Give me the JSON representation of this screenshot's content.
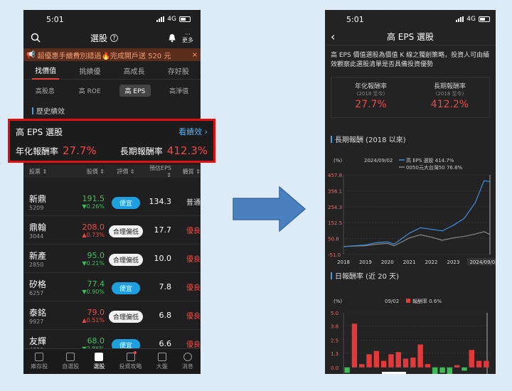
{
  "left_phone": {
    "status_time": "5:01",
    "network": "4G",
    "title": "選股",
    "more_label": "更多",
    "promo_text": "超優惠手續費別錯過🔥完成開戶送 520 元",
    "promo_close": "×",
    "tabs": [
      {
        "label": "找價值",
        "active": true
      },
      {
        "label": "挑績優",
        "active": false
      },
      {
        "label": "高成長",
        "active": false
      },
      {
        "label": "存好股",
        "active": false
      }
    ],
    "subtabs": [
      {
        "label": "高股息",
        "active": false
      },
      {
        "label": "高 ROE",
        "active": false
      },
      {
        "label": "高 EPS",
        "active": true
      },
      {
        "label": "高淨值",
        "active": false
      }
    ],
    "history_label": "歷史績效",
    "highlight": {
      "title": "高 EPS 選股",
      "link": "看績效 ›",
      "annual_label": "年化報酬率",
      "annual_value": "27.7%",
      "long_label": "長期報酬率",
      "long_value": "412.3%"
    },
    "table_headers": [
      "股票 ⇕",
      "股價 ⇕",
      "評價 ⇕",
      "預估EPS ⇕",
      "體質 ⇕"
    ],
    "rows": [
      {
        "name": "新鼎",
        "code": "5209",
        "price": "191.5",
        "change": "▼0.26%",
        "dir": "down",
        "rating": "便宜",
        "rating_type": "cheap",
        "eps": "134.3",
        "level": "普通",
        "level_type": "normal"
      },
      {
        "name": "鼎翰",
        "code": "3044",
        "price": "208.0",
        "change": "▲0.73%",
        "dir": "up",
        "rating": "合理偏低",
        "rating_type": "fair",
        "eps": "17.7",
        "level": "優良",
        "level_type": "good"
      },
      {
        "name": "新產",
        "code": "2850",
        "price": "95.0",
        "change": "▼0.21%",
        "dir": "down",
        "rating": "合理偏低",
        "rating_type": "fair",
        "eps": "10.0",
        "level": "優良",
        "level_type": "good"
      },
      {
        "name": "矽格",
        "code": "6257",
        "price": "77.4",
        "change": "▼0.90%",
        "dir": "down",
        "rating": "便宜",
        "rating_type": "cheap",
        "eps": "7.8",
        "level": "優良",
        "level_type": "good"
      },
      {
        "name": "泰銘",
        "code": "9927",
        "price": "79.0",
        "change": "▲0.51%",
        "dir": "up",
        "rating": "合理偏低",
        "rating_type": "fair",
        "eps": "6.8",
        "level": "優良",
        "level_type": "good"
      },
      {
        "name": "友輝",
        "code": "4933",
        "price": "68.0",
        "change": "▼2.86%",
        "dir": "down",
        "rating": "便宜",
        "rating_type": "cheap",
        "eps": "6.6",
        "level": "優良",
        "level_type": "good"
      }
    ],
    "nav": [
      {
        "label": "庫存股",
        "icon": "briefcase-icon",
        "active": false
      },
      {
        "label": "自選股",
        "icon": "plus-square-icon",
        "active": false
      },
      {
        "label": "選股",
        "icon": "database-icon",
        "active": true
      },
      {
        "label": "投資攻略",
        "icon": "book-icon",
        "active": false
      },
      {
        "label": "大盤",
        "icon": "compass-icon",
        "active": false
      },
      {
        "label": "消息",
        "icon": "chat-icon",
        "active": false
      }
    ]
  },
  "right_phone": {
    "status_time": "5:01",
    "network": "4G",
    "title": "高 EPS 選股",
    "description": "高 EPS 價值選股為價值 K 線之獨創策略，投資人可由績效觀察此選股清單是否具備投資優勢",
    "annual_label": "年化報酬率",
    "annual_sub": "(2018 至今)",
    "annual_value": "27.7%",
    "long_label": "長期報酬率",
    "long_sub": "(2018 至今)",
    "long_value": "412.2%",
    "long_section": "長期報酬 (2018 以來)",
    "daily_section": "日報酬率 (近 20 天)"
  },
  "chart_data": [
    {
      "type": "line",
      "title": "長期報酬 (2018 以來)",
      "ylabel": "(%)",
      "cursor_date": "2024/09/02",
      "x_ticks": [
        "2018",
        "2019",
        "2020",
        "2021",
        "2022",
        "2023",
        "2024/09/02"
      ],
      "y_ticks": [
        "457.8",
        "356.1",
        "254.3",
        "152.5",
        "50.8",
        "-51.0"
      ],
      "ylim": [
        -51.0,
        457.8
      ],
      "x": [
        2018.0,
        2018.5,
        2019.0,
        2019.5,
        2020.0,
        2020.3,
        2020.6,
        2021.0,
        2021.5,
        2022.0,
        2022.5,
        2023.0,
        2023.5,
        2024.0,
        2024.4,
        2024.67
      ],
      "series": [
        {
          "name": "高 EPS 選股 414.7%",
          "color": "#3a8fe0",
          "values": [
            0,
            5,
            10,
            25,
            30,
            15,
            45,
            85,
            120,
            110,
            100,
            135,
            180,
            280,
            420,
            415
          ]
        },
        {
          "name": "0050元大台灣50 76.8%",
          "color": "#888888",
          "values": [
            0,
            3,
            5,
            15,
            20,
            5,
            25,
            55,
            75,
            60,
            40,
            55,
            65,
            80,
            95,
            77
          ]
        }
      ]
    },
    {
      "type": "bar",
      "title": "日報酬率 (近 20 天)",
      "ylabel": "(%)",
      "cursor_date": "09/02",
      "legend": "報酬率 0.6%",
      "y_ticks": [
        "5.0",
        "3.8",
        "2.5",
        "1.3",
        "0.0"
      ],
      "ylim": [
        -0.6,
        5.0
      ],
      "values": [
        -0.5,
        4.0,
        0.3,
        1.2,
        1.5,
        0.6,
        1.2,
        1.4,
        0.8,
        0.9,
        2.1,
        0.3,
        -0.6,
        -0.5,
        -0.6,
        0.2,
        -0.3,
        1.6,
        0.6,
        0.6
      ]
    }
  ]
}
